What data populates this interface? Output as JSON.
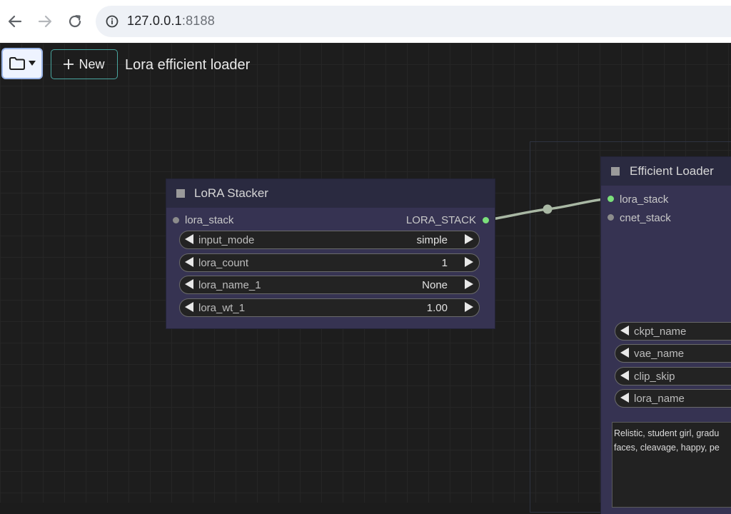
{
  "browser": {
    "url_host": "127.0.0.1",
    "url_port": ":8188"
  },
  "toolbar": {
    "new_label": "New",
    "workflow_title": "Lora efficient loader"
  },
  "lora_stacker": {
    "title": "LoRA Stacker",
    "input_slot": "lora_stack",
    "output_slot": "LORA_STACK",
    "widgets": [
      {
        "label": "input_mode",
        "value": "simple"
      },
      {
        "label": "lora_count",
        "value": "1"
      },
      {
        "label": "lora_name_1",
        "value": "None"
      },
      {
        "label": "lora_wt_1",
        "value": "1.00"
      }
    ]
  },
  "efficient_loader": {
    "title": "Efficient Loader",
    "inputs": [
      "lora_stack",
      "cnet_stack"
    ],
    "widgets": [
      {
        "label": "ckpt_name"
      },
      {
        "label": "vae_name"
      },
      {
        "label": "clip_skip"
      },
      {
        "label": "lora_name"
      }
    ],
    "prompt_text": "Relistic, student girl, gradu\nfaces, cleavage, happy, pe"
  },
  "colors": {
    "connected_slot": "#7be07b",
    "link": "#a9b8a4",
    "node_body": "#363352",
    "node_header": "#2a2a40"
  }
}
